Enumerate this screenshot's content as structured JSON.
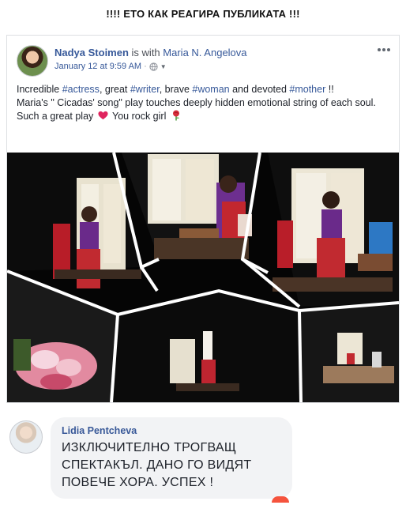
{
  "banner": {
    "text": "!!!! ЕТО КАК РЕАГИРА ПУБЛИКАТА !!!"
  },
  "post": {
    "author": "Nadya Stoimen",
    "with_text": "is with",
    "tagged": "Maria N. Angelova",
    "date_text": "January 12 at 9:59 AM",
    "audience_icon": "globe-icon",
    "line1": {
      "p1": "Incredible ",
      "h1": "#actress",
      "p2": ", great ",
      "h2": "#writer",
      "p3": ", brave ",
      "h3": "#woman",
      "p4": " and devoted ",
      "h4": "#mother",
      "p5": " !!"
    },
    "line2": "Maria's \" Cicadas' song\" play touches deeply hidden emotional string of each soul.",
    "line3_a": "Such a great play",
    "line3_b": "You rock girl"
  },
  "comment": {
    "author": "Lidia Pentcheva",
    "line1": "ИЗКЛЮЧИТЕЛНО ТРОГВАЩ",
    "line2": "СПЕКТАКЪЛ. ДАНО ГО ВИДЯТ",
    "line3": "ПОВЕЧЕ ХОРА. УСПЕХ !"
  },
  "colors": {
    "link": "#365899",
    "hashtag": "#365899",
    "heart": "#e0245e",
    "bubble": "#f2f3f5",
    "stage_curtain": "#c0202a"
  }
}
